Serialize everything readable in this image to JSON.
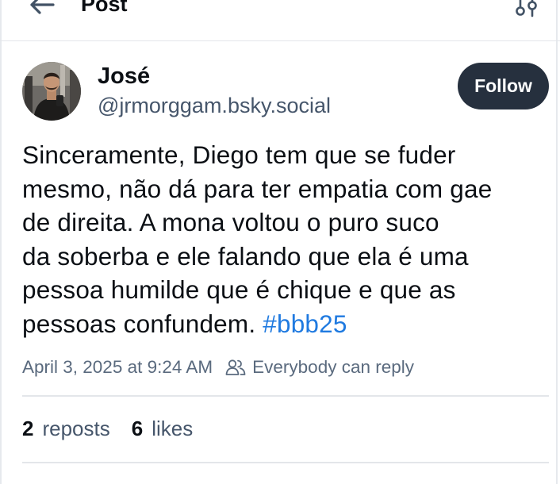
{
  "header": {
    "title": "Post",
    "back_icon": "arrow-left-icon",
    "filter_icon": "sliders-icon"
  },
  "author": {
    "display_name": "José",
    "handle": "@jrmorggam.bsky.social",
    "follow_label": "Follow"
  },
  "post": {
    "lines": [
      "Sinceramente, Diego tem que se fuder",
      "mesmo, não dá para ter empatia com gae",
      "de direita. A mona voltou o puro suco",
      "da soberba e ele falando que ela é uma",
      "pessoa humilde que é chique e que as",
      "pessoas confundem."
    ],
    "hashtag": "#bbb25",
    "timestamp": "April 3, 2025 at 9:24 AM",
    "reply_setting": "Everybody can reply",
    "reply_icon": "people-icon"
  },
  "stats": {
    "reposts_count": "2",
    "reposts_label": "reposts",
    "likes_count": "6",
    "likes_label": "likes"
  },
  "colors": {
    "link": "#1f7ae0",
    "follow_bg": "#26303e",
    "muted": "#5a6a7e"
  }
}
